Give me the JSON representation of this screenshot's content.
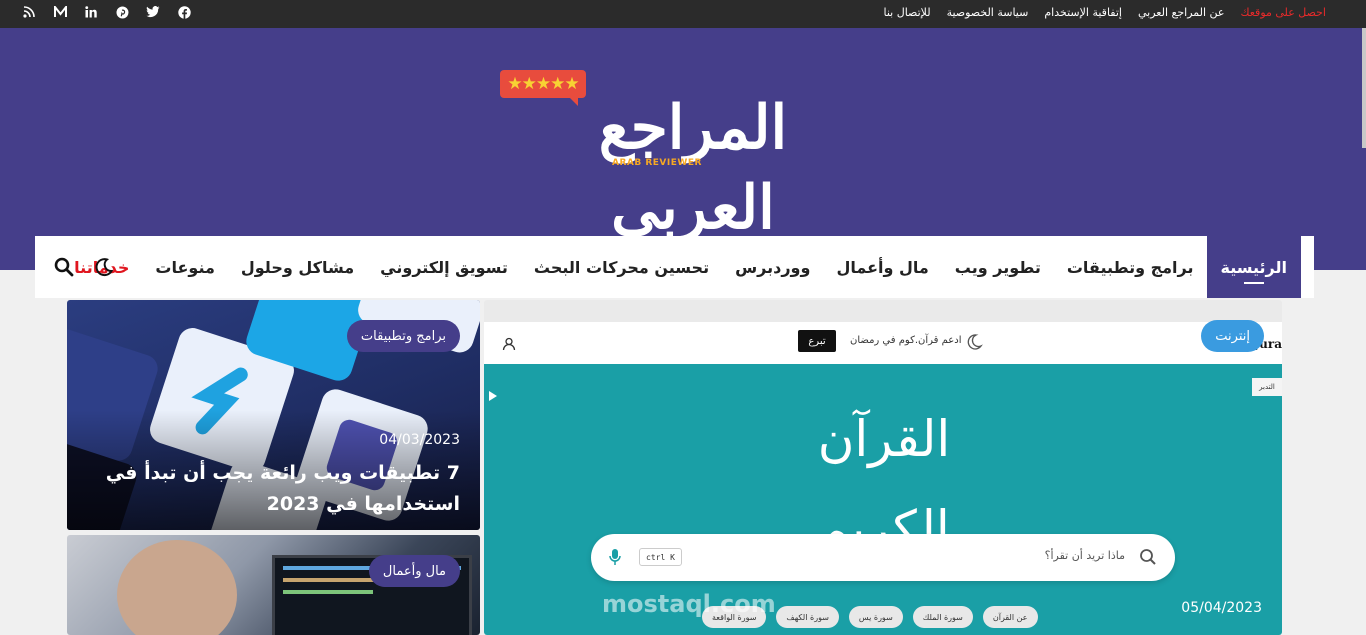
{
  "topbar": {
    "links": [
      "احصل على موقعك",
      "عن المراجع العربي",
      "إتفاقية الإستخدام",
      "سياسة الخصوصية",
      "للإتصال بنا"
    ],
    "social_icons": [
      "rss-icon",
      "medium-icon",
      "linkedin-icon",
      "pinterest-icon",
      "twitter-icon",
      "facebook-icon"
    ]
  },
  "logo": {
    "word": "المراجع العربي",
    "sub": "ARAB REVIEWER",
    "stars": "★★★★★"
  },
  "nav": {
    "items": [
      "الرئيسية",
      "برامج وتطبيقات",
      "تطوير ويب",
      "مال وأعمال",
      "ووردبرس",
      "تحسين محركات البحث",
      "تسويق إلكتروني",
      "مشاكل وحلول",
      "منوعات",
      "خدماتنا"
    ]
  },
  "cards": [
    {
      "category": "برامج وتطبيقات",
      "date": "04/03/2023",
      "title_line1": "7 تطبيقات ويب رائعة يجب أن تبدأ في",
      "title_line2": "استخدامها في 2023"
    },
    {
      "category": "مال وأعمال"
    },
    {
      "category": "إنترنت",
      "date": "05/04/2023",
      "screenshot": {
        "promo": "ادعم قرآن.كوم في رمضان",
        "donate": "تبرع",
        "brand": "Qura",
        "tag": "التدبر",
        "title": "القرآن الكريم",
        "search_placeholder": "ماذا تريد أن تقرأ؟",
        "shortcut": "ctrl  K",
        "chips": [
          "سورة الواقعة",
          "سورة الكهف",
          "سورة يس",
          "سورة الملك",
          "عن القرآن"
        ],
        "watermark": "mostaql.com"
      }
    }
  ],
  "colors": {
    "brand": "#453e8a",
    "accent_red": "#e0161f",
    "badge_blue": "#3a9be0"
  }
}
